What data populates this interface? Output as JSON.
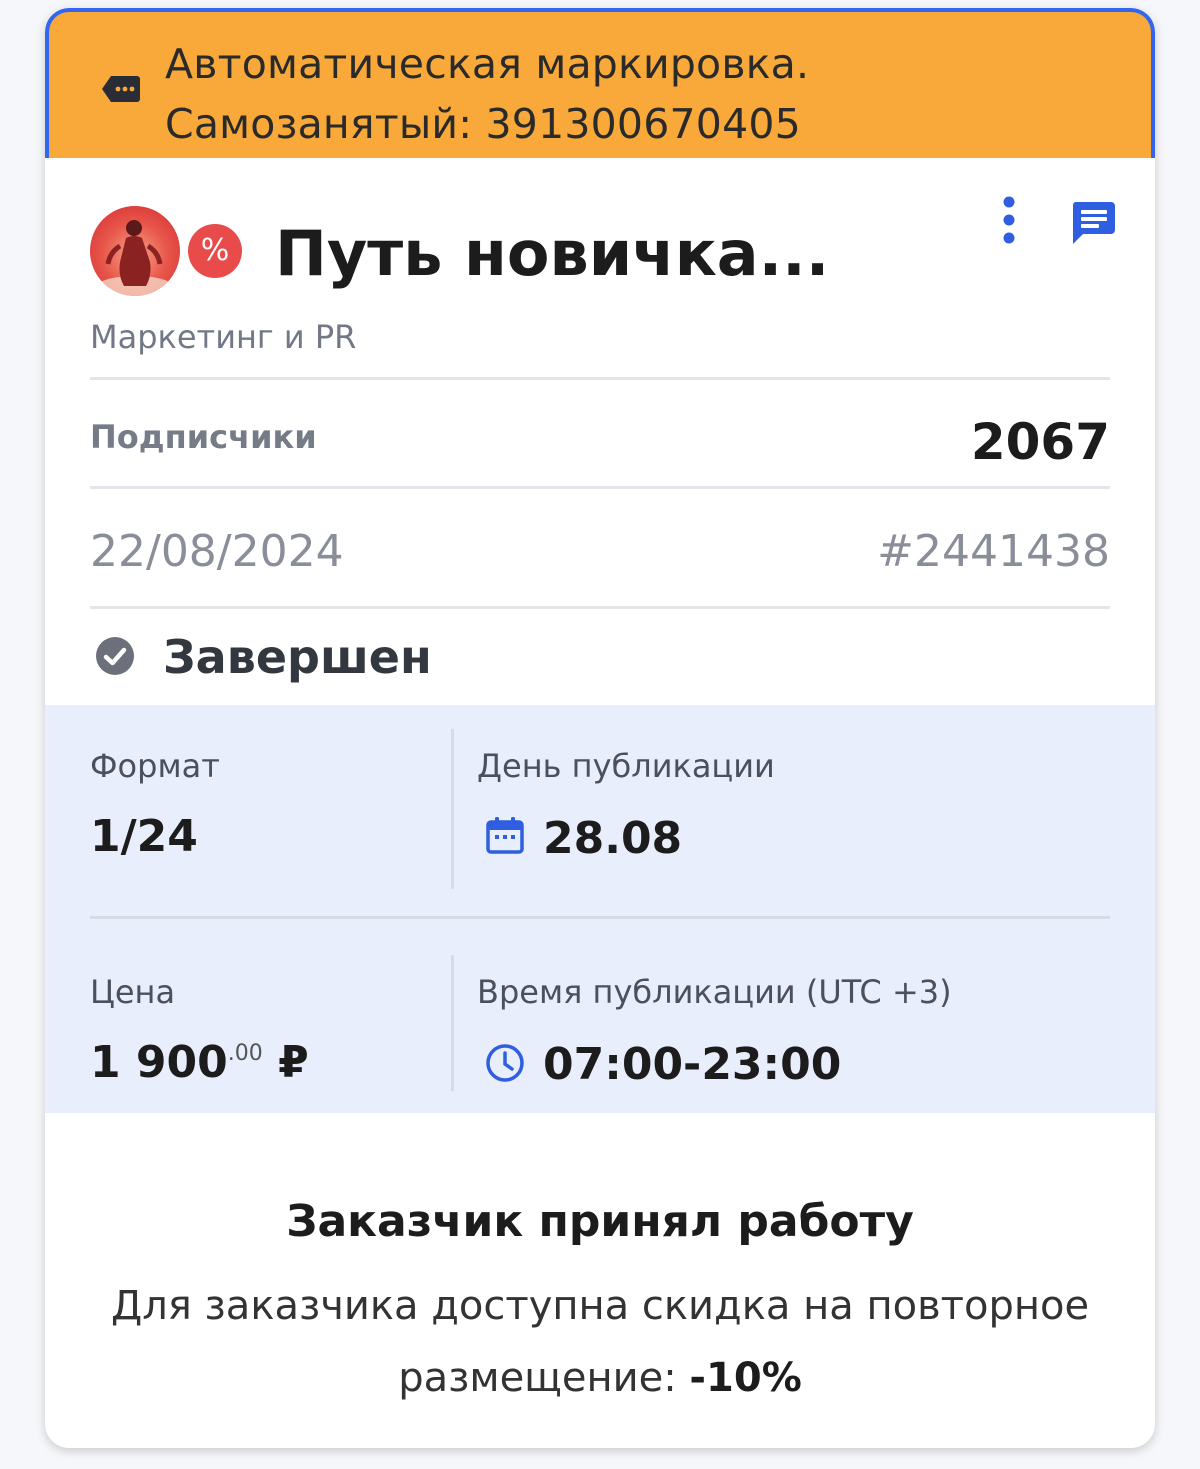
{
  "banner": {
    "line1": "Автоматическая маркировка.",
    "line2": "Самозанятый: 391300670405",
    "icon": "tag-icon",
    "background": "#f8a93a",
    "border": "#3366ee"
  },
  "channel": {
    "title": "Путь новичка...",
    "category": "Маркетинг и PR",
    "discount_symbol": "%",
    "avatar_icon": "dancer-avatar"
  },
  "header_actions": {
    "more_icon": "more-vertical-icon",
    "chat_icon": "chat-icon",
    "accent": "#2f5fe0"
  },
  "subscribers": {
    "label": "Подписчики",
    "value": "2067"
  },
  "order": {
    "date": "22/08/2024",
    "id": "#2441438"
  },
  "status": {
    "label": "Завершен",
    "icon": "check-circle-icon"
  },
  "details": {
    "format_label": "Формат",
    "format_value": "1/24",
    "pub_day_label": "День публикации",
    "pub_day_value": "28.08",
    "price_label": "Цена",
    "price_main": "1 900",
    "price_cents": ".00",
    "price_currency": "₽",
    "pub_time_label": "Время публикации (UTC +3)",
    "pub_time_value": "07:00-23:00"
  },
  "footer": {
    "title": "Заказчик принял работу",
    "text": "Для заказчика доступна скидка на повторное размещение: ",
    "discount": "-10%"
  }
}
